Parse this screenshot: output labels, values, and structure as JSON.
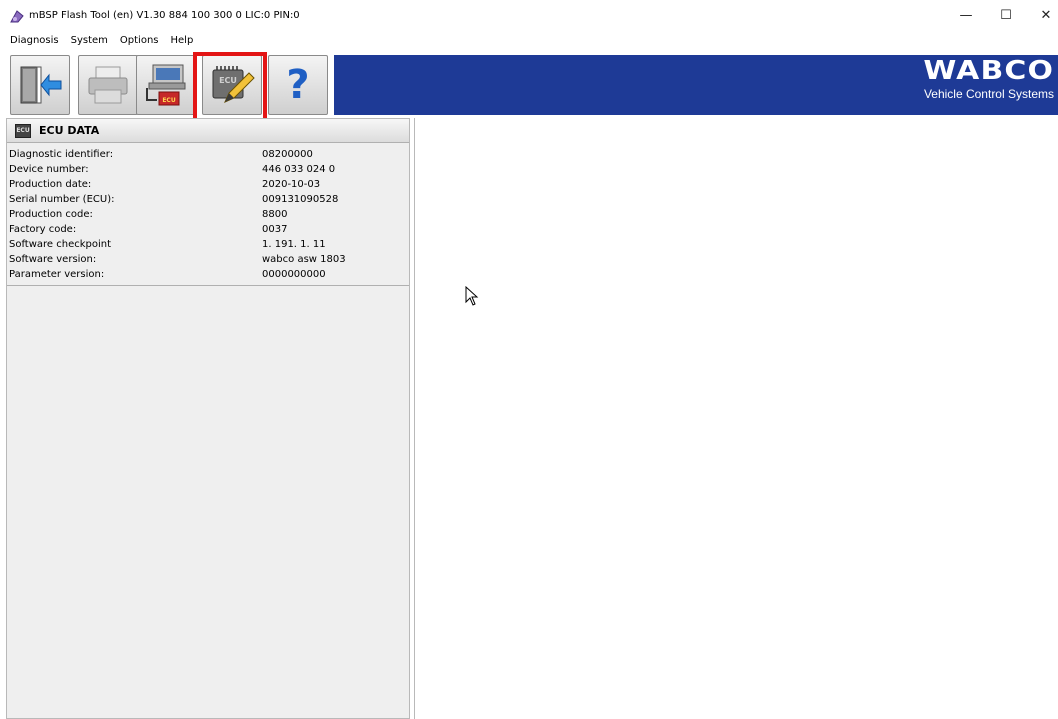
{
  "window": {
    "title": "mBSP Flash Tool (en) V1.30  884 100 300 0  LIC:0 PIN:0",
    "minimize_glyph": "—",
    "maximize_glyph": "☐",
    "close_glyph": "✕"
  },
  "menu": {
    "items": [
      "Diagnosis",
      "System",
      "Options",
      "Help"
    ]
  },
  "toolbar": {
    "help_glyph": "?",
    "ecu_chip_label": "ECU",
    "highlighted_button": "ecu-edit-button",
    "highlight_color": "#e31515",
    "band_color": "#1e3a96"
  },
  "logo": {
    "word": "WABCO",
    "subtitle": "Vehicle Control Systems"
  },
  "ecu_panel": {
    "title": "ECU DATA",
    "icon_label": "ECU",
    "rows": [
      {
        "label": "Diagnostic identifier:",
        "value": "08200000"
      },
      {
        "label": "Device number:",
        "value": "446 033 024 0"
      },
      {
        "label": "Production date:",
        "value": "2020-10-03"
      },
      {
        "label": "Serial number (ECU):",
        "value": "009131090528"
      },
      {
        "label": "Production code:",
        "value": "8800"
      },
      {
        "label": "Factory code:",
        "value": "0037"
      },
      {
        "label": "Software checkpoint",
        "value": "1. 191. 1. 11"
      },
      {
        "label": "Software version:",
        "value": "wabco asw 1803"
      },
      {
        "label": "Parameter version:",
        "value": "0000000000"
      }
    ]
  }
}
